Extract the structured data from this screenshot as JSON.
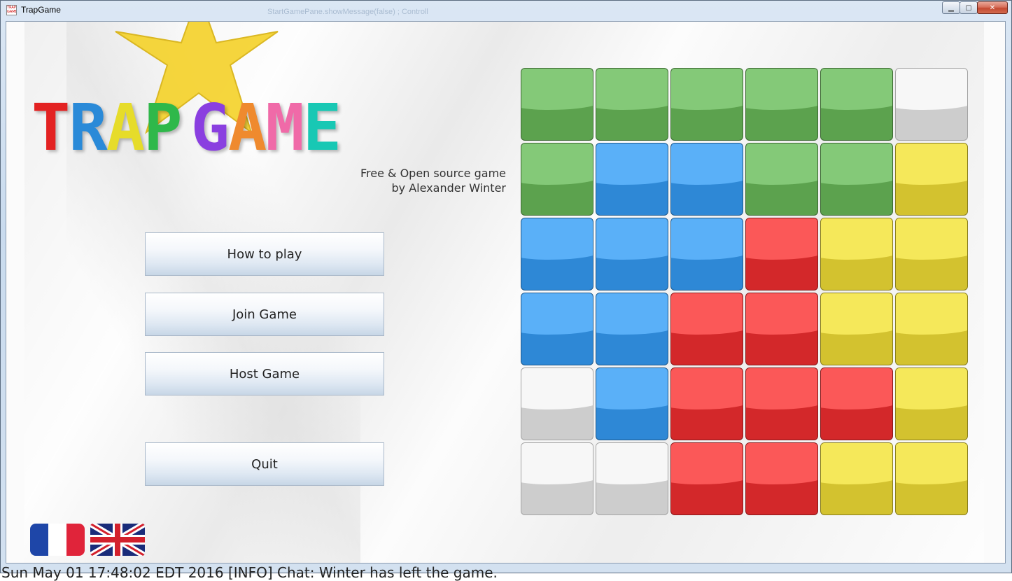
{
  "window": {
    "title": "TrapGame",
    "background_title": "StartGamePane.showMessage(false) ; Controll",
    "minimize_glyph": "▁",
    "maximize_glyph": "▢",
    "close_glyph": "✕"
  },
  "logo": {
    "letters": [
      {
        "char": "T",
        "color": "#e32222"
      },
      {
        "char": "R",
        "color": "#2a8ad8"
      },
      {
        "char": "A",
        "color": "#e6dc2a"
      },
      {
        "char": "P",
        "color": "#2fb84a"
      },
      {
        "char": " ",
        "color": "#000000"
      },
      {
        "char": "G",
        "color": "#8a3fe0"
      },
      {
        "char": "A",
        "color": "#ef8a2e"
      },
      {
        "char": "M",
        "color": "#f06aa8"
      },
      {
        "char": "E",
        "color": "#18c8b4"
      }
    ],
    "star_color": "#f5d433",
    "subtitle_line1": "Free & Open source game",
    "subtitle_line2": "by Alexander Winter"
  },
  "menu": {
    "how_to_play": "How to play",
    "join_game": "Join Game",
    "host_game": "Host Game",
    "quit": "Quit"
  },
  "languages": [
    {
      "name": "french-flag-icon"
    },
    {
      "name": "uk-flag-icon"
    }
  ],
  "board": {
    "rows": [
      [
        "green",
        "green",
        "green",
        "green",
        "green",
        "white"
      ],
      [
        "green",
        "blue",
        "blue",
        "green",
        "green",
        "yellow"
      ],
      [
        "blue",
        "blue",
        "blue",
        "red",
        "yellow",
        "yellow"
      ],
      [
        "blue",
        "blue",
        "red",
        "red",
        "yellow",
        "yellow"
      ],
      [
        "white",
        "blue",
        "red",
        "red",
        "red",
        "yellow"
      ],
      [
        "white",
        "white",
        "red",
        "red",
        "yellow",
        "yellow"
      ]
    ]
  },
  "status_line": "Sun May 01 17:48:02 EDT 2016 [INFO] Chat: Winter has left the game."
}
